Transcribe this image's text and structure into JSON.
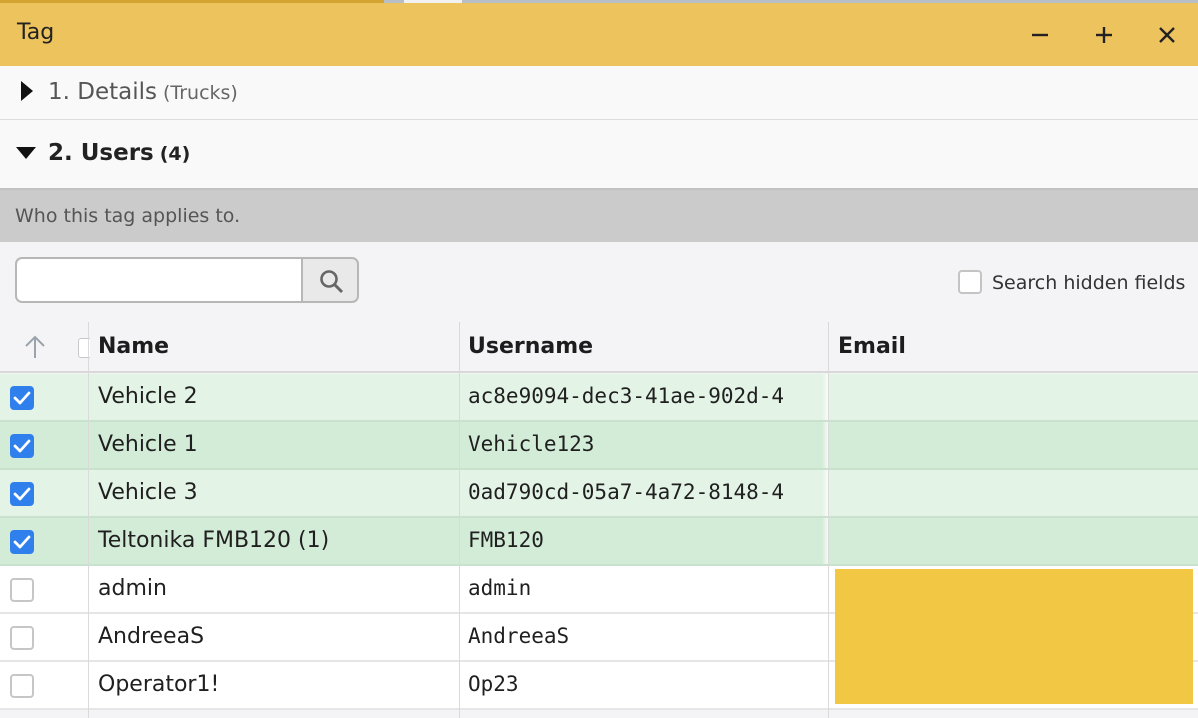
{
  "window": {
    "title": "Tag",
    "controls": {
      "minimize": "minimize-icon",
      "maximize": "plus-icon",
      "close": "close-icon"
    },
    "accent_color": "#edc35d"
  },
  "sections": [
    {
      "label": "1. Details",
      "count": "(Trucks)",
      "expanded": false
    },
    {
      "label": "2. Users",
      "count": "(4)",
      "expanded": true
    }
  ],
  "users_panel": {
    "description": "Who this tag applies to.",
    "search": {
      "value": "",
      "placeholder": ""
    },
    "search_hidden_label": "Search hidden fields",
    "search_hidden_checked": false
  },
  "table": {
    "columns": [
      "Name",
      "Username",
      "Email"
    ],
    "rows": [
      {
        "checked": true,
        "name": "Vehicle 2",
        "username": "ac8e9094-dec3-41ae-902d-4",
        "email": ""
      },
      {
        "checked": true,
        "name": "Vehicle 1",
        "username": "Vehicle123",
        "email": ""
      },
      {
        "checked": true,
        "name": "Vehicle 3",
        "username": "0ad790cd-05a7-4a72-8148-4",
        "email": ""
      },
      {
        "checked": true,
        "name": "Teltonika FMB120 (1)",
        "username": "FMB120",
        "email": ""
      },
      {
        "checked": false,
        "name": "admin",
        "username": "admin",
        "email": ""
      },
      {
        "checked": false,
        "name": "AndreeaS",
        "username": "AndreeaS",
        "email": ""
      },
      {
        "checked": false,
        "name": "Operator1!",
        "username": "Op23",
        "email": ""
      }
    ]
  },
  "colors": {
    "checkbox_on": "#2f80ed",
    "selected_row": "#d3ecd8",
    "redaction": "#f2c744"
  }
}
